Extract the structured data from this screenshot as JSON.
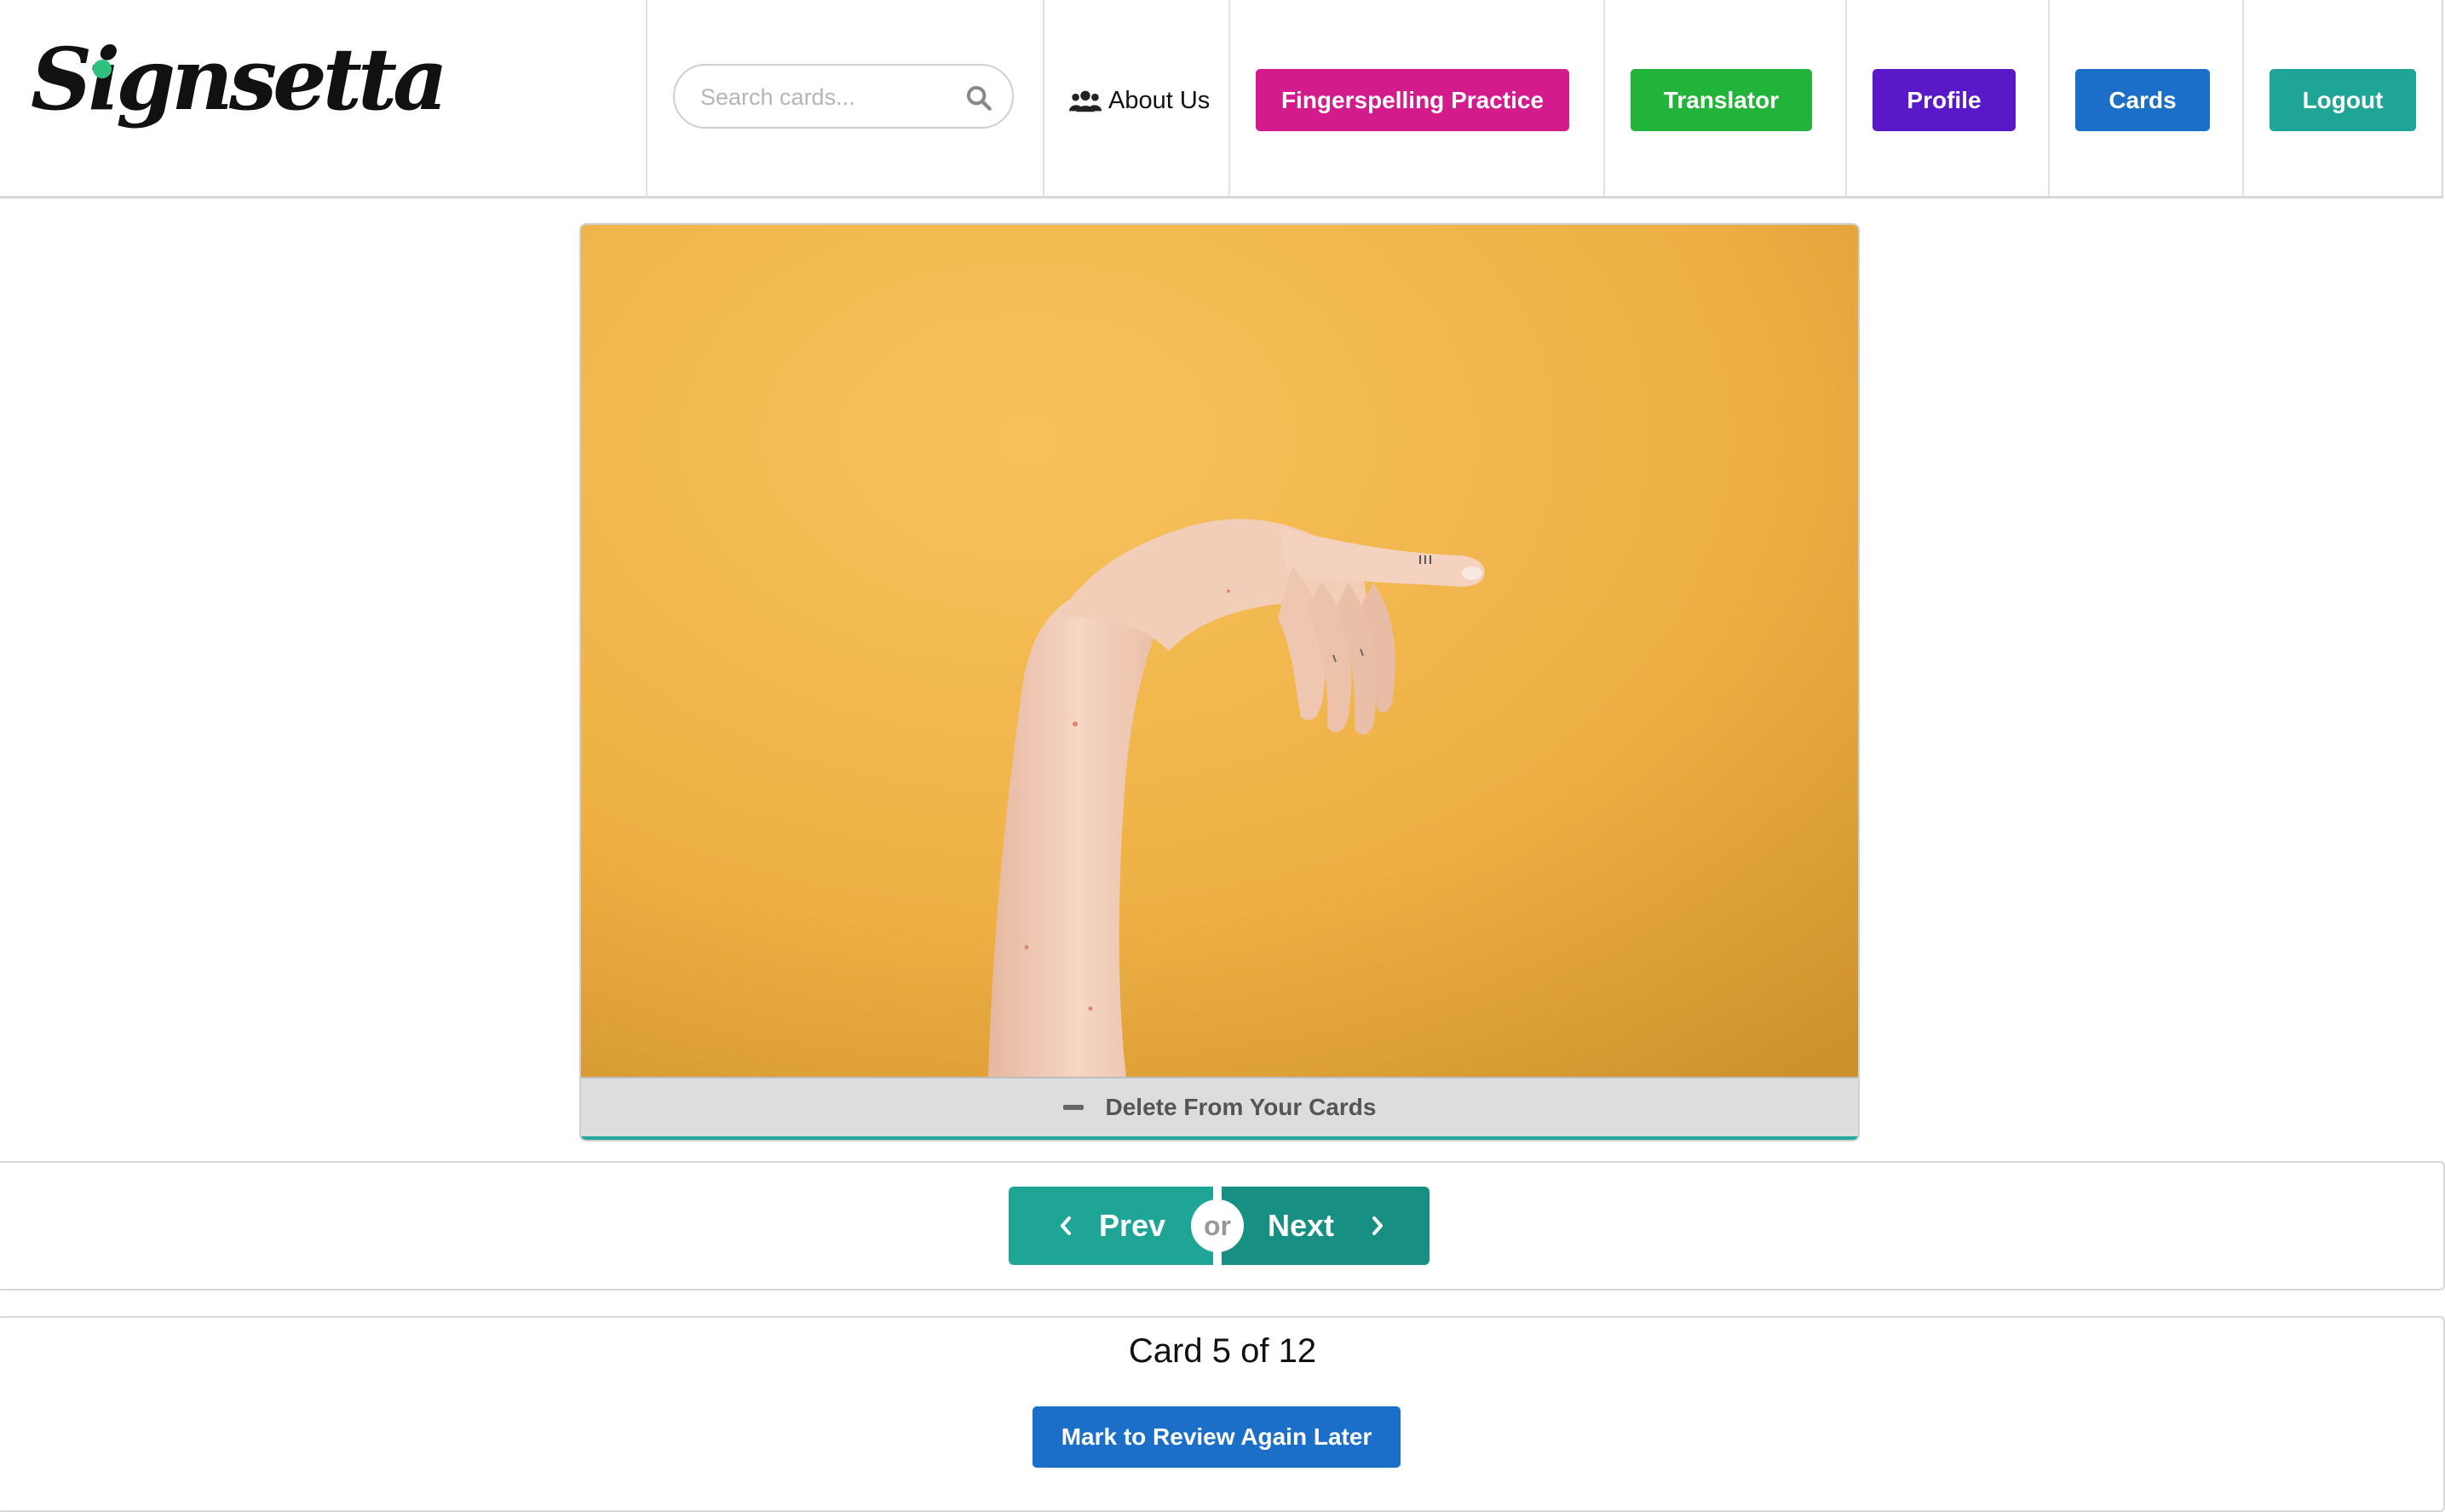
{
  "app": {
    "logo_text": "Signsetta"
  },
  "header": {
    "search": {
      "placeholder": "Search cards..."
    },
    "about_label": "About Us",
    "nav_buttons": [
      {
        "label": "Fingerspelling Practice",
        "color": "#d41b8c"
      },
      {
        "label": "Translator",
        "color": "#22b43a"
      },
      {
        "label": "Profile",
        "color": "#5a19c8"
      },
      {
        "label": "Cards",
        "color": "#1c6fc9"
      },
      {
        "label": "Logout",
        "color": "#1fa596"
      }
    ]
  },
  "card": {
    "image_icon": "hand-sign-photo",
    "image_background": "#f0b648",
    "delete_label": "Delete From Your Cards"
  },
  "navigation": {
    "prev_label": "Prev",
    "or_label": "or",
    "next_label": "Next"
  },
  "status": {
    "counter_text": "Card 5 of 12",
    "review_label": "Mark to Review Again Later"
  },
  "colors": {
    "accent_teal": "#1fa596",
    "review_blue": "#1c6fc9"
  }
}
